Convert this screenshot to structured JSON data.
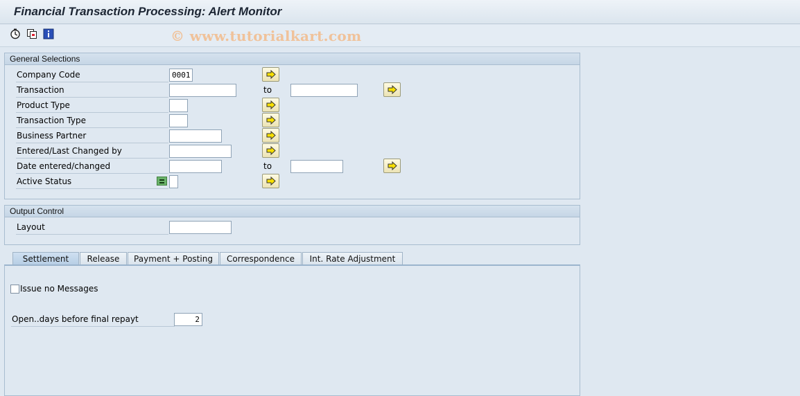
{
  "window": {
    "title": "Financial Transaction Processing: Alert Monitor"
  },
  "toolbar": {
    "icons": [
      "execute-icon",
      "get-variant-icon",
      "program-info-icon"
    ]
  },
  "watermark": "© www.tutorialkart.com",
  "general_selections": {
    "title": "General Selections",
    "to_label": "to",
    "rows": {
      "company_code": {
        "label": "Company Code",
        "value": "0001"
      },
      "transaction": {
        "label": "Transaction",
        "from": "",
        "to": ""
      },
      "product_type": {
        "label": "Product Type",
        "value": ""
      },
      "transaction_type": {
        "label": "Transaction Type",
        "value": ""
      },
      "business_partner": {
        "label": "Business Partner",
        "value": ""
      },
      "entered_changed_by": {
        "label": "Entered/Last Changed by",
        "value": ""
      },
      "date_entered_changed": {
        "label": "Date entered/changed",
        "from": "",
        "to": ""
      },
      "active_status": {
        "label": "Active Status",
        "value": ""
      }
    }
  },
  "output_control": {
    "title": "Output Control",
    "layout": {
      "label": "Layout",
      "value": ""
    }
  },
  "tabs": [
    {
      "label": "Settlement",
      "active": true
    },
    {
      "label": "Release",
      "active": false
    },
    {
      "label": "Payment + Posting",
      "active": false
    },
    {
      "label": "Correspondence",
      "active": false
    },
    {
      "label": "Int. Rate Adjustment",
      "active": false
    }
  ],
  "settlement": {
    "issue_no_messages": {
      "label": "Issue no Messages",
      "checked": false
    },
    "open_days": {
      "label": "Open..days before final repayt",
      "value": "2"
    }
  },
  "colors": {
    "background": "#dfe8f1",
    "accent": "#6bb36b",
    "button": "#f4edc8"
  }
}
